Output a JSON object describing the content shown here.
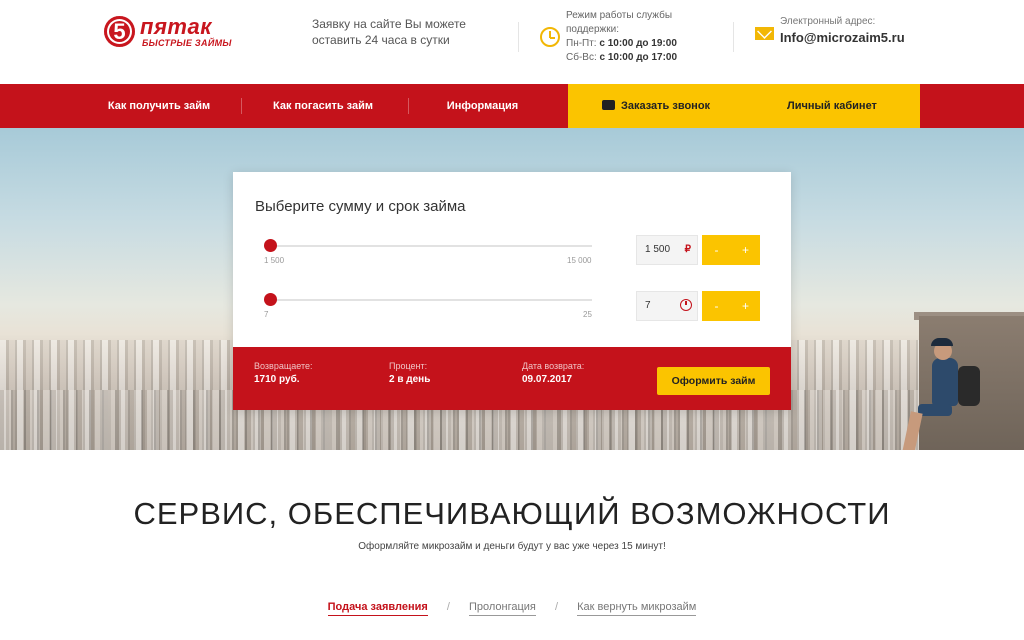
{
  "header": {
    "logo_digit": "5",
    "logo_name": "пятак",
    "logo_sub": "БЫСТРЫЕ ЗАЙМЫ",
    "apply_text": "Заявку на сайте Вы можете оставить 24 часа в сутки",
    "hours_title": "Режим работы службы поддержки:",
    "hours_weekdays_label": "Пн-Пт:",
    "hours_weekdays_value": "с 10:00 до 19:00",
    "hours_weekend_label": "Сб-Вс:",
    "hours_weekend_value": "с 10:00 до 17:00",
    "email_label": "Электронный адрес:",
    "email": "Info@microzaim5.ru"
  },
  "nav": {
    "items": [
      "Как получить займ",
      "Как погасить займ",
      "Информация"
    ],
    "callback_label": "Заказать звонок",
    "cabinet_label": "Личный кабинет"
  },
  "calculator": {
    "title": "Выберите сумму и срок займа",
    "amount": {
      "min_label": "1 500",
      "max_label": "15 000",
      "value": "1 500",
      "currency": "₽",
      "level": 0.0
    },
    "term": {
      "min_label": "7",
      "max_label": "25",
      "value": "7",
      "level": 0.0
    },
    "minus": "-",
    "plus": "+",
    "summary": {
      "return_label": "Возвращаете:",
      "return_value": "1710 руб.",
      "percent_label": "Процент:",
      "percent_value": "2 в день",
      "date_label": "Дата возврата:",
      "date_value": "09.07.2017"
    },
    "submit_label": "Оформить займ"
  },
  "service": {
    "title": "СЕРВИС, ОБЕСПЕЧИВАЮЩИЙ ВОЗМОЖНОСТИ",
    "subtitle": "Оформляйте микрозайм и деньги будут у вас уже через 15 минут!",
    "tabs": [
      "Подача заявления",
      "Пролонгация",
      "Как вернуть микрозайм"
    ],
    "separator": "/"
  },
  "colors": {
    "brand_red": "#c4121b",
    "accent_yellow": "#fbc400"
  }
}
